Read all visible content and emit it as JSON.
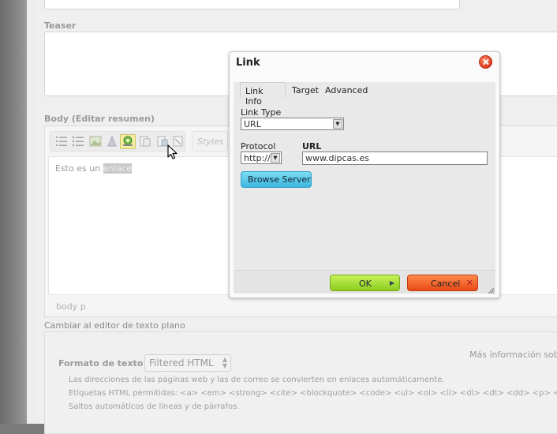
{
  "form": {
    "teaser_label": "Teaser",
    "body_label": "Body",
    "body_summary_link": "(Editar resumen)",
    "editor": {
      "styles_placeholder": "Styles",
      "content_prefix": "Esto es un",
      "content_selected": "enlace",
      "status_path": "body  p"
    },
    "switch_plain_link": "Cambiar al editor de texto plano",
    "format": {
      "more_info": "Más información sobre",
      "label": "Formato de texto",
      "selected": "Filtered HTML",
      "tips": [
        "Las direcciones de las páginas web y las de correo se convierten en enlaces automáticamente.",
        "Etiquetas HTML permitidas: <a> <em> <strong> <cite> <blockquote> <code> <ul> <ol> <li> <dl> <dt> <dd> <p> <br>",
        "Saltos automáticos de líneas y de párrafos."
      ]
    }
  },
  "dialog": {
    "title": "Link",
    "tabs": [
      "Link Info",
      "Target",
      "Advanced"
    ],
    "link_type_label": "Link Type",
    "link_type_value": "URL",
    "protocol_label": "Protocol",
    "protocol_value": "http://",
    "url_label": "URL",
    "url_value": "www.dipcas.es",
    "browse_button": "Browse Server",
    "ok_button": "OK",
    "cancel_button": "Cancel"
  },
  "colors": {
    "ok": "#9ad62a",
    "cancel": "#f0561c",
    "browse": "#4cc2e6",
    "close": "#e5431f"
  }
}
